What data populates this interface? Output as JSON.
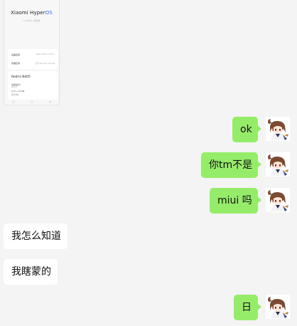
{
  "screenshot": {
    "brand": "Xiaomi Hyper",
    "brand_os": "OS",
    "tagline": "以人为中心 万物互联",
    "rows": [
      {
        "label": "设备名称",
        "value": "Redmi Note 13 Pro+"
      },
      {
        "label": "存储空间",
        "value": "已用 256 GB / 512 GB"
      }
    ],
    "model": "Redmi N405",
    "meta": [
      "系统版本号",
      "OS1.0",
      "运行内存",
      "12.0 + 4.0 GB"
    ],
    "nav": [
      "▢",
      "○",
      "◁"
    ]
  },
  "messages": [
    {
      "side": "sent",
      "text": "ok"
    },
    {
      "side": "sent",
      "text": "你tm不是"
    },
    {
      "side": "sent",
      "text": "miui 吗"
    },
    {
      "side": "received",
      "text": "我怎么知道"
    },
    {
      "side": "received",
      "text": "我瞎蒙的"
    },
    {
      "side": "sent",
      "text": "日"
    }
  ],
  "colors": {
    "background": "#f4f4f4",
    "sent_bubble": "#95ec69",
    "received_bubble": "#ffffff",
    "hyperos_accent": "#3a6ef0"
  }
}
